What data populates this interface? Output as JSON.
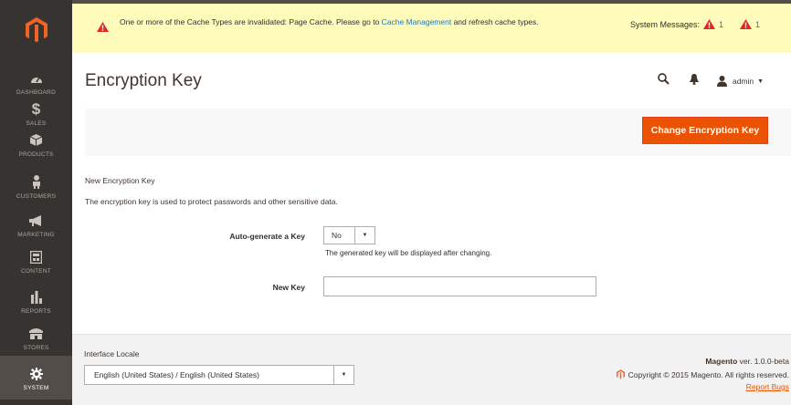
{
  "sidebar": {
    "logo": "magento-logo",
    "items": [
      {
        "label": "DASHBOARD",
        "icon": "dashboard-icon"
      },
      {
        "label": "SALES",
        "icon": "dollar-icon"
      },
      {
        "label": "PRODUCTS",
        "icon": "cube-icon"
      },
      {
        "label": "CUSTOMERS",
        "icon": "person-icon"
      },
      {
        "label": "MARKETING",
        "icon": "megaphone-icon"
      },
      {
        "label": "CONTENT",
        "icon": "content-icon"
      },
      {
        "label": "REPORTS",
        "icon": "bar-chart-icon"
      },
      {
        "label": "STORES",
        "icon": "store-icon"
      },
      {
        "label": "SYSTEM",
        "icon": "gear-icon"
      }
    ]
  },
  "message": {
    "text_before": "One or more of the Cache Types are invalidated: Page Cache. Please go to ",
    "link": "Cache Management",
    "text_after": " and refresh cache types.",
    "system_label": "System Messages:",
    "count_critical": "1",
    "count_major": "1"
  },
  "header": {
    "title": "Encryption Key",
    "user": "admin"
  },
  "actions": {
    "change_key": "Change Encryption Key"
  },
  "form": {
    "fieldset_title": "New Encryption Key",
    "description": "The encryption key is used to protect passwords and other sensitive data.",
    "auto_generate_label": "Auto-generate a Key",
    "auto_generate_value": "No",
    "auto_generate_note": "The generated key will be displayed after changing.",
    "new_key_label": "New Key",
    "new_key_value": ""
  },
  "footer": {
    "locale_label": "Interface Locale",
    "locale_value": "English (United States) / English (United States)",
    "brand": "Magento",
    "version": " ver. 1.0.0-beta",
    "copyright": "Copyright © 2015 Magento. All rights reserved.",
    "report_bugs": "Report Bugs"
  },
  "colors": {
    "accent": "#eb5202",
    "sidebar": "#373330",
    "message_bg": "#fffbbb",
    "link": "#1979c3"
  }
}
